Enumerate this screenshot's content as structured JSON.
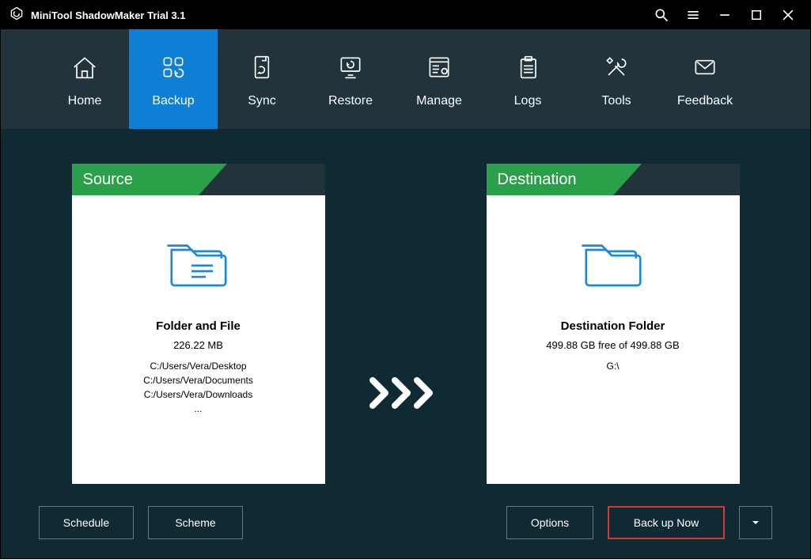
{
  "titlebar": {
    "title": "MiniTool ShadowMaker Trial 3.1"
  },
  "nav": {
    "home": "Home",
    "backup": "Backup",
    "sync": "Sync",
    "restore": "Restore",
    "manage": "Manage",
    "logs": "Logs",
    "tools": "Tools",
    "feedback": "Feedback"
  },
  "source": {
    "header": "Source",
    "title": "Folder and File",
    "size": "226.22 MB",
    "paths": [
      "C:/Users/Vera/Desktop",
      "C:/Users/Vera/Documents",
      "C:/Users/Vera/Downloads"
    ],
    "more": "..."
  },
  "destination": {
    "header": "Destination",
    "title": "Destination Folder",
    "free": "499.88 GB free of 499.88 GB",
    "path": "G:\\"
  },
  "bottom": {
    "schedule": "Schedule",
    "scheme": "Scheme",
    "options": "Options",
    "backup_now": "Back up Now"
  }
}
